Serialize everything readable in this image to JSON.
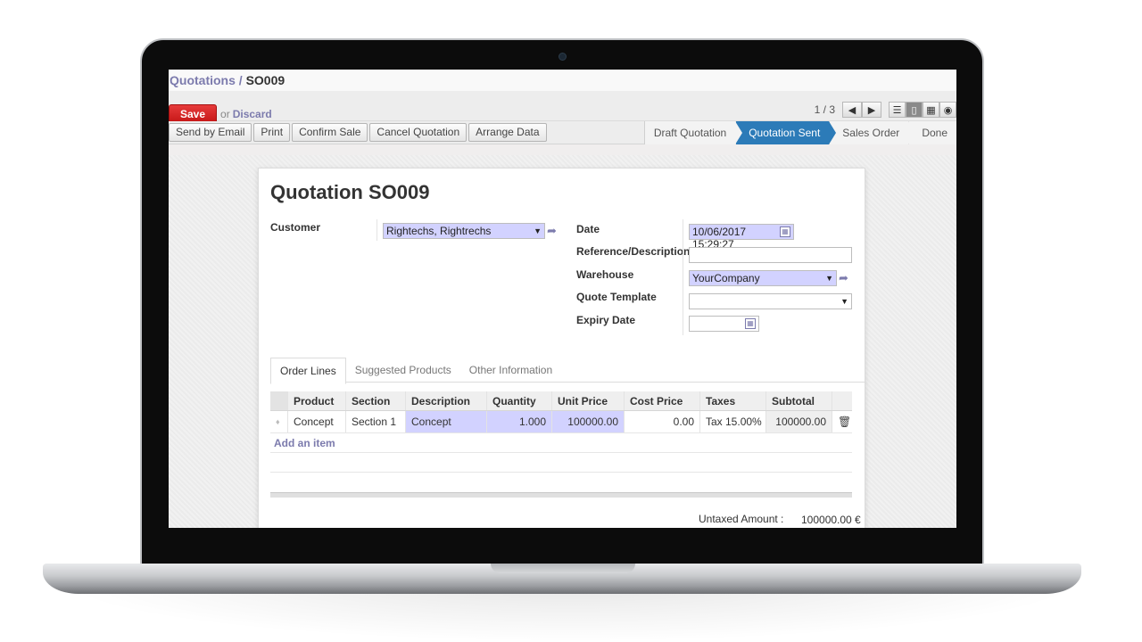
{
  "breadcrumb": {
    "parent": "Quotations",
    "separator": "/",
    "current": "SO009"
  },
  "actions": {
    "save": "Save",
    "or": "or",
    "discard": "Discard"
  },
  "pager": {
    "count": "1 / 3",
    "prev_icon": "arrow-left-icon",
    "next_icon": "arrow-right-icon"
  },
  "views": [
    "list-view-icon",
    "form-view-icon",
    "calendar-view-icon",
    "graph-view-icon"
  ],
  "toolbar": {
    "buttons": [
      "Send by Email",
      "Print",
      "Confirm Sale",
      "Cancel Quotation",
      "Arrange Data"
    ]
  },
  "stages": [
    {
      "label": "Draft Quotation",
      "active": false
    },
    {
      "label": "Quotation Sent",
      "active": true
    },
    {
      "label": "Sales Order",
      "active": false
    },
    {
      "label": "Done",
      "active": false
    }
  ],
  "form": {
    "title_prefix": "Quotation",
    "title_number": "SO009",
    "customer_label": "Customer",
    "customer_value": "Rightechs, Rightrechs",
    "date_label": "Date",
    "date_value": "10/06/2017 15:29:27",
    "reference_label": "Reference/Description",
    "reference_value": "",
    "warehouse_label": "Warehouse",
    "warehouse_value": "YourCompany",
    "template_label": "Quote Template",
    "template_value": "",
    "expiry_label": "Expiry Date",
    "expiry_value": ""
  },
  "tabs": [
    "Order Lines",
    "Suggested Products",
    "Other Information"
  ],
  "order_lines": {
    "headers": [
      "Product",
      "Section",
      "Description",
      "Quantity",
      "Unit Price",
      "Cost Price",
      "Taxes",
      "Subtotal"
    ],
    "rows": [
      {
        "product": "Concept",
        "section": "Section 1",
        "description": "Concept",
        "quantity": "1.000",
        "unit_price": "100000.00",
        "cost_price": "0.00",
        "taxes": "Tax 15.00%",
        "subtotal": "100000.00"
      }
    ],
    "add_item": "Add an item"
  },
  "totals": {
    "untaxed_label": "Untaxed Amount :",
    "untaxed_value": "100000.00 €"
  },
  "colors": {
    "accent": "#7c7bad",
    "save": "#d42020",
    "stage_active": "#2c7bb8",
    "required_field": "#d2d2ff"
  }
}
